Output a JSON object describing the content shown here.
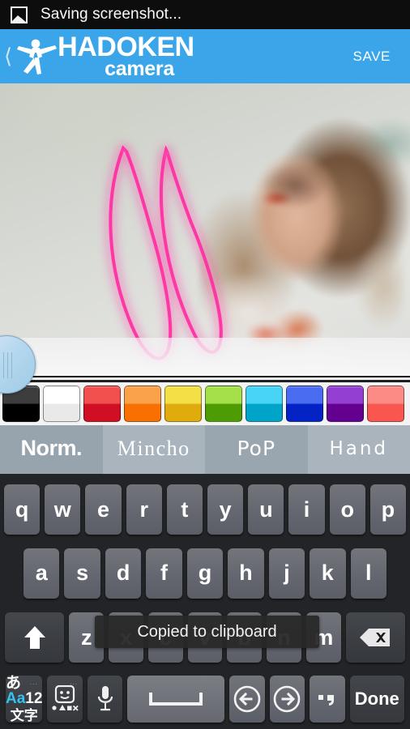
{
  "statusbar": {
    "icon": "gallery-icon",
    "text": "Saving screenshot..."
  },
  "appbar": {
    "back_icon": "back-chevron-icon",
    "logo_icon": "hadoken-figure-icon",
    "brand_main": "HADOKEN",
    "brand_sub": "camera",
    "save_label": "SAVE",
    "accent_color": "#3aa5e8"
  },
  "canvas": {
    "name": "photo-edit-canvas",
    "drawing": "pink-neon-bunny-ears",
    "drawing_color": "#ff1f9c"
  },
  "slider": {
    "name": "brush-size-slider-handle",
    "color": "#b6d8ee"
  },
  "palette": {
    "swatches": [
      {
        "name": "swatch-black",
        "top": "#3d3d3d",
        "bottom": "#000000"
      },
      {
        "name": "swatch-white",
        "top": "#ffffff",
        "bottom": "#e9e9e9"
      },
      {
        "name": "swatch-red",
        "top": "#f1504e",
        "bottom": "#d10f24"
      },
      {
        "name": "swatch-orange",
        "top": "#f9a24a",
        "bottom": "#f87000"
      },
      {
        "name": "swatch-yellow",
        "top": "#f3df46",
        "bottom": "#e0ab0d"
      },
      {
        "name": "swatch-green",
        "top": "#a5e04a",
        "bottom": "#4d9c06"
      },
      {
        "name": "swatch-cyan",
        "top": "#48d4f5",
        "bottom": "#00a4c9"
      },
      {
        "name": "swatch-blue",
        "top": "#4a6cf0",
        "bottom": "#0323c4"
      },
      {
        "name": "swatch-purple",
        "top": "#9340d2",
        "bottom": "#640090"
      },
      {
        "name": "swatch-pink",
        "top": "#fb8b84",
        "bottom": "#f9564f"
      }
    ]
  },
  "fontbar": {
    "tabs": [
      {
        "label": "Norm.",
        "name": "font-tab-normal",
        "selected": true
      },
      {
        "label": "Mincho",
        "name": "font-tab-mincho",
        "selected": false
      },
      {
        "label": "PoP",
        "name": "font-tab-pop",
        "selected": false
      },
      {
        "label": "Hand",
        "name": "font-tab-hand",
        "selected": false
      }
    ]
  },
  "keyboard": {
    "row1": [
      "q",
      "w",
      "e",
      "r",
      "t",
      "y",
      "u",
      "i",
      "o",
      "p"
    ],
    "row2": [
      "a",
      "s",
      "d",
      "f",
      "g",
      "h",
      "j",
      "k",
      "l"
    ],
    "row3_letters": [
      "z",
      "x",
      "c",
      "v",
      "b",
      "n",
      "m"
    ],
    "shift_icon": "shift-arrow-icon",
    "backspace_icon": "backspace-icon",
    "row4": {
      "lang_top_a": "あ",
      "lang_top_aa": "Aa",
      "lang_top_12": "12",
      "lang_bottom": "文字",
      "lang_dots": "...",
      "emoji_icon": "emoji-face-icon",
      "emoji_dots": "...",
      "mic_icon": "microphone-icon",
      "space_icon": "space-bar-icon",
      "left_icon": "arrow-left-circle-icon",
      "right_icon": "arrow-right-circle-icon",
      "punct_label": "punctuation-key",
      "done_label": "Done"
    }
  },
  "toast": {
    "message": "Copied to clipboard"
  }
}
